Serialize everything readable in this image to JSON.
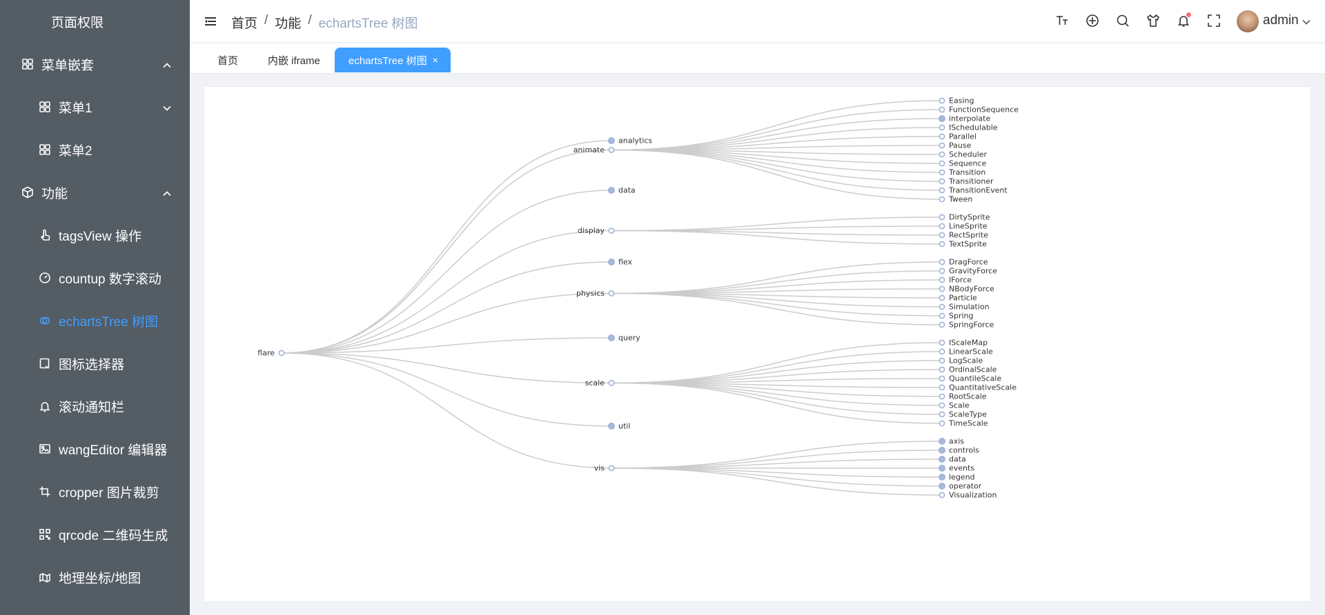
{
  "sidebar": {
    "items": [
      {
        "label": "页面权限",
        "icon": "",
        "level": 0,
        "arrow": ""
      },
      {
        "label": "菜单嵌套",
        "icon": "grid-icon",
        "level": 0,
        "arrow": "up"
      },
      {
        "label": "菜单1",
        "icon": "grid-icon",
        "level": 1,
        "arrow": "down"
      },
      {
        "label": "菜单2",
        "icon": "grid-icon",
        "level": 1,
        "arrow": ""
      },
      {
        "label": "功能",
        "icon": "box-icon",
        "level": 0,
        "arrow": "up"
      },
      {
        "label": "tagsView 操作",
        "icon": "pointer-icon",
        "level": 1,
        "arrow": ""
      },
      {
        "label": "countup 数字滚动",
        "icon": "gauge-icon",
        "level": 1,
        "arrow": ""
      },
      {
        "label": "echartsTree 树图",
        "icon": "link-icon",
        "level": 1,
        "arrow": "",
        "active": true
      },
      {
        "label": "图标选择器",
        "icon": "edit-icon",
        "level": 1,
        "arrow": ""
      },
      {
        "label": "滚动通知栏",
        "icon": "bell-icon",
        "level": 1,
        "arrow": ""
      },
      {
        "label": "wangEditor 编辑器",
        "icon": "picture-icon",
        "level": 1,
        "arrow": ""
      },
      {
        "label": "cropper 图片裁剪",
        "icon": "crop-icon",
        "level": 1,
        "arrow": ""
      },
      {
        "label": "qrcode 二维码生成",
        "icon": "qrcode-icon",
        "level": 1,
        "arrow": ""
      },
      {
        "label": "地理坐标/地图",
        "icon": "map-icon",
        "level": 1,
        "arrow": ""
      }
    ],
    "active_color": "#409eff",
    "background": "#545c64"
  },
  "header": {
    "breadcrumb": [
      "首页",
      "功能",
      "echartsTree 树图"
    ],
    "toolbar_icons": [
      "font-size-icon",
      "component-icon",
      "search-icon",
      "skin-icon",
      "bell-icon",
      "fullscreen-icon"
    ],
    "username": "admin"
  },
  "tags": [
    {
      "label": "首页"
    },
    {
      "label": "内嵌 iframe"
    },
    {
      "label": "echartsTree 树图",
      "active": true,
      "close": "×"
    }
  ],
  "tree": {
    "root": "flare",
    "children": [
      {
        "name": "analytics",
        "collapsed": true,
        "children": []
      },
      {
        "name": "animate",
        "children": [
          {
            "name": "Easing"
          },
          {
            "name": "FunctionSequence"
          },
          {
            "name": "interpolate",
            "collapsed": true
          },
          {
            "name": "ISchedulable"
          },
          {
            "name": "Parallel"
          },
          {
            "name": "Pause"
          },
          {
            "name": "Scheduler"
          },
          {
            "name": "Sequence"
          },
          {
            "name": "Transition"
          },
          {
            "name": "Transitioner"
          },
          {
            "name": "TransitionEvent"
          },
          {
            "name": "Tween"
          }
        ]
      },
      {
        "name": "data",
        "collapsed": true,
        "children": []
      },
      {
        "name": "display",
        "children": [
          {
            "name": "DirtySprite"
          },
          {
            "name": "LineSprite"
          },
          {
            "name": "RectSprite"
          },
          {
            "name": "TextSprite"
          }
        ]
      },
      {
        "name": "flex",
        "collapsed": true,
        "children": []
      },
      {
        "name": "physics",
        "children": [
          {
            "name": "DragForce"
          },
          {
            "name": "GravityForce"
          },
          {
            "name": "IForce"
          },
          {
            "name": "NBodyForce"
          },
          {
            "name": "Particle"
          },
          {
            "name": "Simulation"
          },
          {
            "name": "Spring"
          },
          {
            "name": "SpringForce"
          }
        ]
      },
      {
        "name": "query",
        "collapsed": true,
        "children": []
      },
      {
        "name": "scale",
        "children": [
          {
            "name": "IScaleMap"
          },
          {
            "name": "LinearScale"
          },
          {
            "name": "LogScale"
          },
          {
            "name": "OrdinalScale"
          },
          {
            "name": "QuantileScale"
          },
          {
            "name": "QuantitativeScale"
          },
          {
            "name": "RootScale"
          },
          {
            "name": "Scale"
          },
          {
            "name": "ScaleType"
          },
          {
            "name": "TimeScale"
          }
        ]
      },
      {
        "name": "util",
        "collapsed": true,
        "children": []
      },
      {
        "name": "vis",
        "children": [
          {
            "name": "axis",
            "collapsed": true
          },
          {
            "name": "controls",
            "collapsed": true
          },
          {
            "name": "data",
            "collapsed": true
          },
          {
            "name": "events",
            "collapsed": true
          },
          {
            "name": "legend",
            "collapsed": true
          },
          {
            "name": "operator",
            "collapsed": true
          },
          {
            "name": "Visualization"
          }
        ]
      }
    ],
    "colors": {
      "line": "#cccccc",
      "node_stroke": "#9db2d8",
      "node_filled": "#a9bbdc",
      "label": "#333333"
    }
  }
}
